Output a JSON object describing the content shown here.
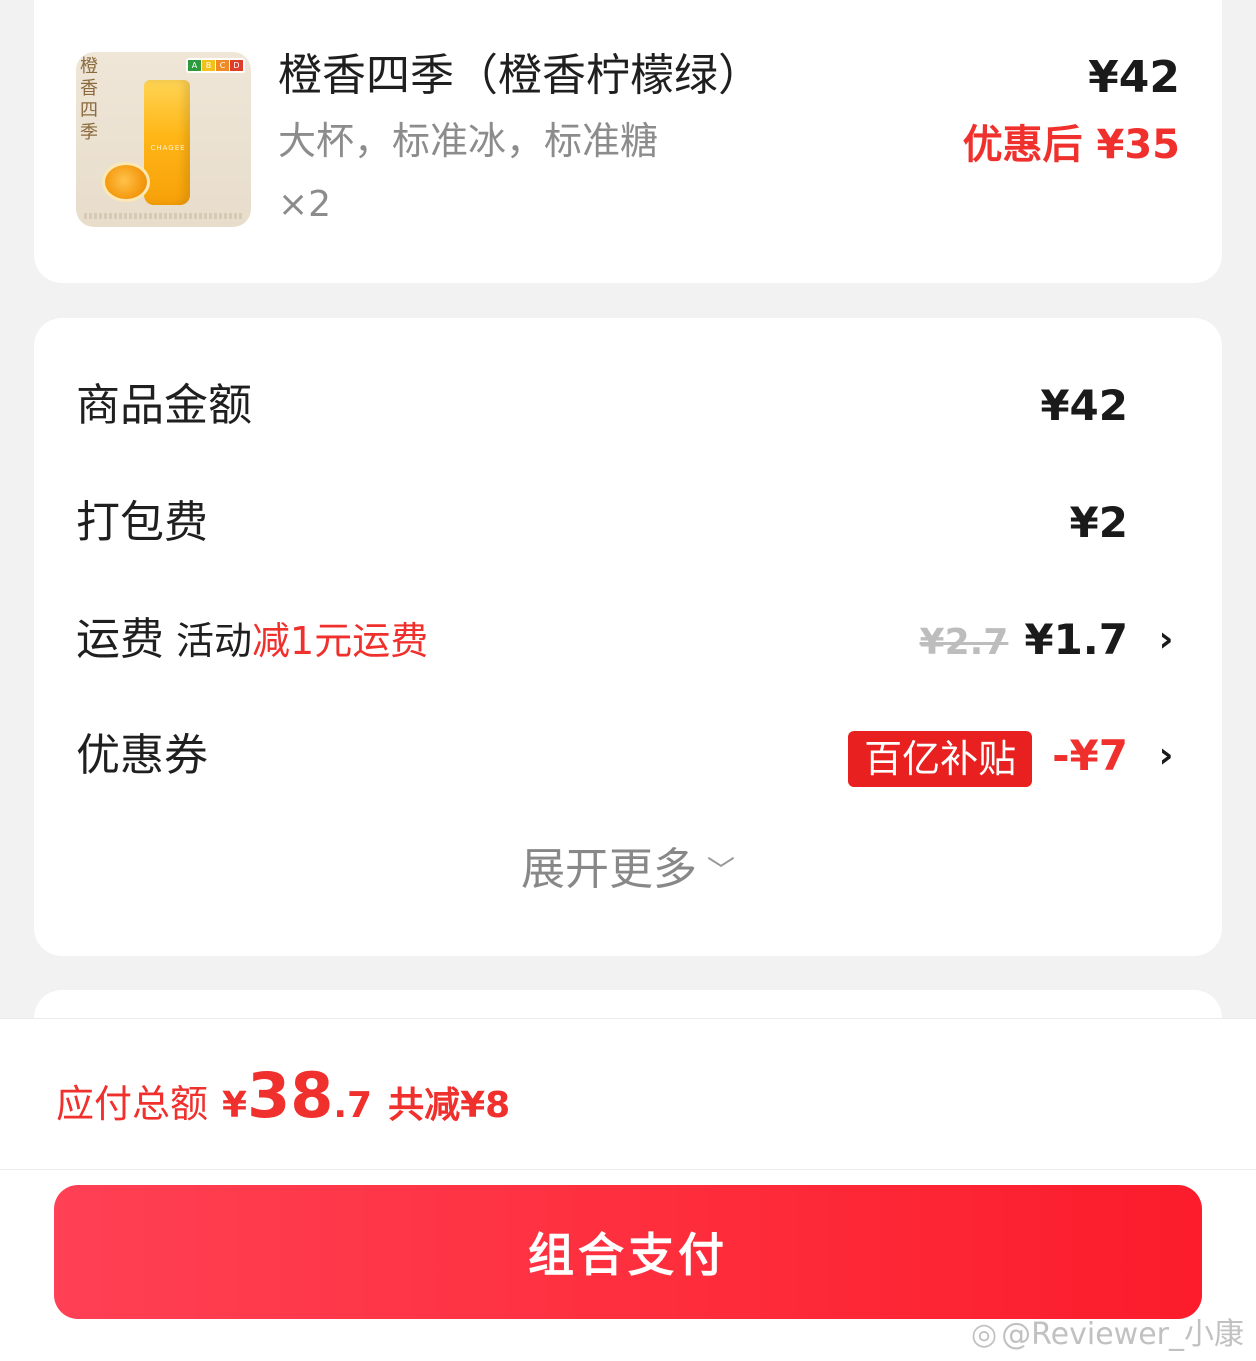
{
  "product": {
    "image_text": "橙香四季",
    "image_brand": "CHAGEE",
    "grades": [
      "A",
      "B",
      "C",
      "D"
    ],
    "name": "橙香四季（橙香柠檬绿）",
    "spec": "大杯，标准冰，标准糖",
    "qty": "×2",
    "price": "¥42",
    "after_label": "优惠后",
    "after_price": "¥35"
  },
  "summary": {
    "goods_label": "商品金额",
    "goods_value": "¥42",
    "packing_label": "打包费",
    "packing_value": "¥2",
    "delivery_label": "运费",
    "delivery_activity": "活动",
    "delivery_promo": "减1元运费",
    "delivery_old": "¥2.7",
    "delivery_value": "¥1.7",
    "coupon_label": "优惠券",
    "coupon_tag": "百亿补贴",
    "coupon_value": "-¥7",
    "expand_label": "展开更多"
  },
  "bottom": {
    "total_label": "应付总额",
    "total_yen": "¥",
    "total_int": "38",
    "total_dec": ".7",
    "saved": "共减¥8",
    "pay_button": "组合支付"
  },
  "watermark": "@Reviewer_小康",
  "colors": {
    "accent_red": "#f0302d",
    "button_red": "#fe2f3e",
    "background": "#f2f2f2"
  },
  "icons": [
    "chevron-right-icon",
    "chevron-down-icon",
    "weibo-icon"
  ]
}
